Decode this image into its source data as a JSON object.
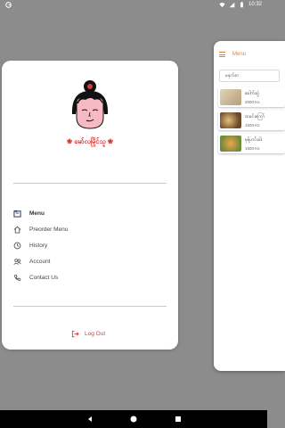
{
  "status_bar": {
    "time": "10:32",
    "left_icon": "google-icon",
    "icons": [
      "wifi-icon",
      "signal-icon",
      "battery-icon"
    ]
  },
  "background_app": {
    "title": "Menu",
    "search_value": "မနုက်စာ",
    "items": [
      {
        "name": "ခေါက်ဆွဲ",
        "price": "2000 Ks",
        "thumb_color": "#c9b79a"
      },
      {
        "name": "ထမင်းကြော်",
        "price": "1500 Ks",
        "thumb_color": "#8f6a3e"
      },
      {
        "name": "မုန့်ဟင်းခါး",
        "price": "1500 Ks",
        "thumb_color": "#d9893a"
      }
    ]
  },
  "drawer": {
    "brand": "❀ မော်လမြိုင်သူ ❀",
    "menu": [
      {
        "label": "Menu",
        "icon": "menu-book-icon",
        "active": true
      },
      {
        "label": "Preorder Menu",
        "icon": "home-icon",
        "active": false
      },
      {
        "label": "History",
        "icon": "history-icon",
        "active": false
      },
      {
        "label": "Account",
        "icon": "people-icon",
        "active": false
      },
      {
        "label": "Contact Us",
        "icon": "phone-icon",
        "active": false
      }
    ],
    "logout_label": "Log Out"
  },
  "colors": {
    "accent": "#e0842a",
    "brand_red": "#c9302c",
    "logout_red": "#e23b3b"
  }
}
